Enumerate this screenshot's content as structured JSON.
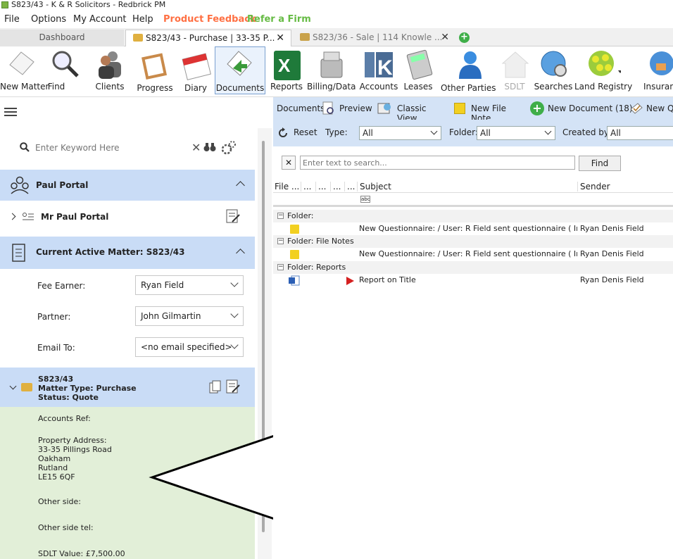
{
  "window": {
    "title": "S823/43 - K & R Solicitors - Redbrick PM"
  },
  "menu": {
    "file": "File",
    "options": "Options",
    "account": "My Account",
    "help": "Help",
    "feedback": "Product Feedback",
    "refer": "Refer a Firm"
  },
  "tabs": {
    "dashboard": "Dashboard",
    "tab1": "S823/43 - Purchase | 33-35 P...",
    "tab2": "S823/36 - Sale | 114 Knowle ..."
  },
  "toolbar": {
    "new_matter": "New Matter",
    "find": "Find",
    "clients": "Clients",
    "progress": "Progress",
    "diary": "Diary",
    "documents": "Documents",
    "reports": "Reports",
    "billing": "Billing/Data",
    "accounts": "Accounts",
    "leases": "Leases",
    "other_parties": "Other Parties",
    "sdlt": "SDLT",
    "searches": "Searches",
    "land_registry": "Land Registry",
    "insurance": "Insuranc"
  },
  "search": {
    "placeholder": "Enter Keyword Here"
  },
  "portal": {
    "header": "Paul Portal",
    "client": "Mr Paul Portal"
  },
  "active_matter": {
    "header": "Current Active Matter: S823/43",
    "fee_earner_label": "Fee Earner:",
    "fee_earner": "Ryan Field",
    "partner_label": "Partner:",
    "partner": "John Gilmartin",
    "email_label": "Email To:",
    "email": "<no email specified>"
  },
  "matter_card": {
    "ref": "S823/43",
    "type": "Matter Type: Purchase",
    "status": "Status: Quote",
    "accounts_ref": "Accounts Ref:",
    "property_label": "Property Address:",
    "addr1": "33-35 Pillings Road",
    "addr2": "Oakham",
    "addr3": "Rutland",
    "addr4": "LE15 6QF",
    "other_side": "Other side:",
    "other_tel": "Other side tel:",
    "sdlt": "SDLT Value: £7,500.00"
  },
  "docs_toolbar": {
    "documents": "Documents",
    "preview": "Preview",
    "classic": "Classic View",
    "new_file_note": "New File Note",
    "new_document": "New Document (18)",
    "new_q": "New Q"
  },
  "filters": {
    "reset": "Reset",
    "type_label": "Type:",
    "type": "All",
    "folder_label": "Folder:",
    "folder": "All",
    "created_label": "Created by:",
    "created": "All"
  },
  "find": {
    "placeholder": "Enter text to search...",
    "button": "Find",
    "clear": "✕"
  },
  "grid": {
    "columns": {
      "file": "File ...",
      "c2": "...",
      "c3": "...",
      "c4": "...",
      "c5": "...",
      "subject": "Subject",
      "sender": "Sender"
    },
    "groups": [
      {
        "title": "Folder:",
        "subject": "New Questionnaire:  / User: R Field sent questionnaire ( Initial Pu",
        "sender": "Ryan Denis Field"
      },
      {
        "title": "Folder: File Notes",
        "subject": "New Questionnaire:  / User: R Field sent questionnaire ( Initial Pu",
        "sender": "Ryan Denis Field"
      },
      {
        "title": "Folder: Reports",
        "subject": "Report on Title",
        "sender": "Ryan Denis Field"
      }
    ]
  },
  "colors": {
    "header_blue": "#c9dcf6",
    "card_green": "#e2efd8",
    "feedback": "#ff7043",
    "refer": "#66bb44"
  }
}
